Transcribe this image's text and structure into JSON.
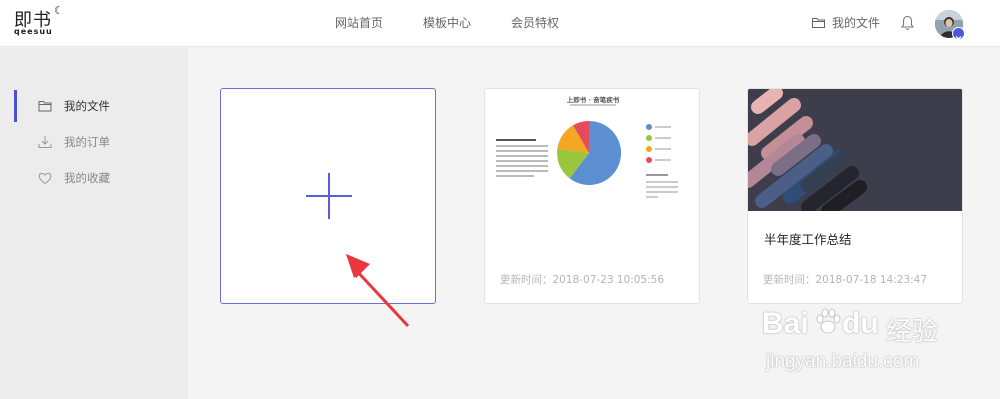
{
  "header": {
    "logo": {
      "main": "即书",
      "sub": "qeesuu"
    },
    "nav": [
      {
        "label": "网站首页"
      },
      {
        "label": "模板中心"
      },
      {
        "label": "会员特权"
      }
    ],
    "my_files_label": "我的文件"
  },
  "sidebar": {
    "items": [
      {
        "label": "我的文件",
        "icon": "folder-icon",
        "active": true
      },
      {
        "label": "我的订单",
        "icon": "download-icon",
        "active": false
      },
      {
        "label": "我的收藏",
        "icon": "heart-icon",
        "active": false
      }
    ]
  },
  "cards": [
    {
      "type": "new",
      "icon": "plus-icon"
    },
    {
      "type": "document",
      "preview": {
        "title": "上即书 · 奋笔疾书",
        "chart": "pie",
        "legend_colors": [
          "#5b8fd1",
          "#9bc53d",
          "#f5a623",
          "#e54b5b"
        ]
      },
      "updated": "更新时间：2018-07-23 10:05:56"
    },
    {
      "type": "document",
      "title": "半年度工作总结",
      "updated": "更新时间：2018-07-18 14:23:47"
    }
  ],
  "watermark": {
    "brand_a": "Bai",
    "brand_b": "du",
    "brand_cn": "经验",
    "url": "jingyan.baidu.com"
  },
  "colors": {
    "accent": "#4a4fd6",
    "arrow": "#e8383d"
  }
}
